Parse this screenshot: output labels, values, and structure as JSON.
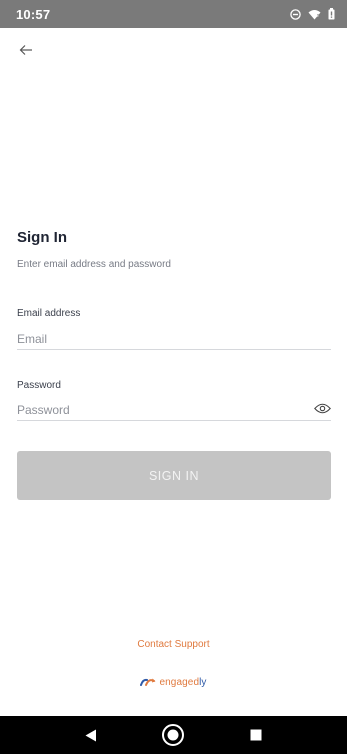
{
  "status_bar": {
    "time": "10:57",
    "icons": [
      "do-not-disturb-icon",
      "wifi-icon",
      "battery-icon"
    ]
  },
  "header": {
    "back_icon": "arrow-left-icon"
  },
  "signin": {
    "title": "Sign In",
    "subtitle": "Enter email address and password",
    "email_label": "Email address",
    "email_placeholder": "Email",
    "email_value": "",
    "password_label": "Password",
    "password_placeholder": "Password",
    "password_value": "",
    "eye_icon": "eye-icon",
    "button_label": "SIGN IN"
  },
  "footer": {
    "contact_support": "Contact Support",
    "brand_main": "engaged",
    "brand_suffix": "ly"
  },
  "nav": {
    "back_icon": "triangle-back-icon",
    "home_icon": "circle-home-icon",
    "recents_icon": "square-recents-icon"
  },
  "colors": {
    "status_bar": "#7a7a7a",
    "button_disabled": "#c4c4c4",
    "accent_orange": "#e07a3f",
    "accent_blue": "#2f5aa8",
    "nav_bar": "#000000"
  }
}
